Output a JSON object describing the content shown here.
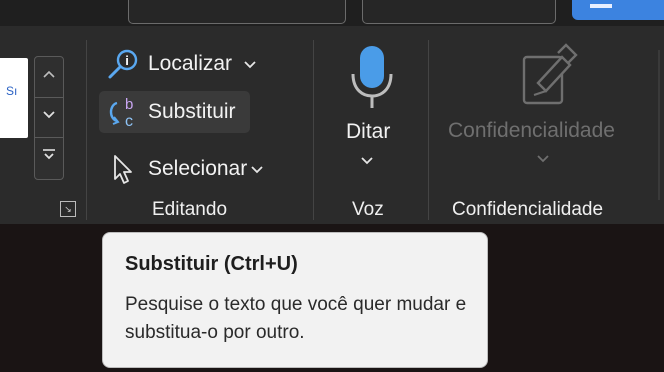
{
  "ribbon": {
    "editando": {
      "label": "Editando",
      "localizar": "Localizar",
      "substituir": "Substituir",
      "selecionar": "Selecionar"
    },
    "voz": {
      "label": "Voz",
      "ditar": "Ditar"
    },
    "confidencialidade": {
      "label": "Confidencialidade",
      "button": "Confidencialidade"
    }
  },
  "tooltip": {
    "title": "Substituir (Ctrl+U)",
    "description": "Pesquise o texto que você quer mudar e substitua-o por outro."
  },
  "colors": {
    "accent_blue": "#3c83e0",
    "ribbon_bg": "#2b2b2b",
    "tooltip_bg": "#f2f2f2",
    "disabled_text": "#6f6f6f"
  },
  "icons": [
    "search-icon",
    "replace-icon",
    "select-cursor-icon",
    "microphone-icon",
    "sensitivity-label-icon"
  ]
}
